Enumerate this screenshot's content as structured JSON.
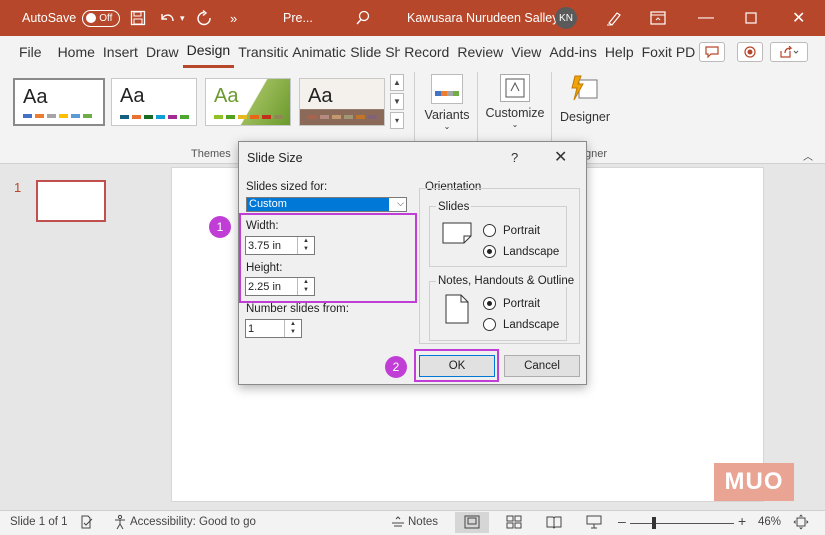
{
  "title_bar": {
    "autosave_label": "AutoSave",
    "autosave_state": "Off",
    "more_label": "»",
    "doc_title": "Pre...",
    "user_name": "Kawusara Nurudeen Salley",
    "user_initials": "KN"
  },
  "ribbon_tabs": [
    "File",
    "Home",
    "Insert",
    "Draw",
    "Design",
    "Transitio",
    "Animatic",
    "Slide Sho",
    "Record",
    "Review",
    "View",
    "Add-ins",
    "Help",
    "Foxit PD"
  ],
  "active_tab": "Design",
  "themes_group": {
    "label": "Themes",
    "thumb_text": "Aa"
  },
  "variants": {
    "label": "Variants"
  },
  "customize": {
    "label": "Customize"
  },
  "designer": {
    "label": "Designer",
    "group_label": "gner"
  },
  "slide_panel": {
    "slide_number": "1"
  },
  "dialog": {
    "title": "Slide Size",
    "help": "?",
    "close": "✕",
    "slides_sized_for_label": "Slides sized for:",
    "slides_sized_for_value": "Custom",
    "width_label": "Width:",
    "width_value": "3.75 in",
    "height_label": "Height:",
    "height_value": "2.25 in",
    "number_slides_label": "Number slides from:",
    "number_slides_value": "1",
    "orientation_label": "Orientation",
    "slides_section_label": "Slides",
    "portrait_label": "Portrait",
    "landscape_label": "Landscape",
    "notes_section_label": "Notes, Handouts & Outline",
    "notes_portrait_label": "Portrait",
    "notes_landscape_label": "Landscape",
    "ok_label": "OK",
    "cancel_label": "Cancel"
  },
  "annotations": {
    "badge_1": "1",
    "badge_2": "2"
  },
  "watermark": "MUO",
  "status_bar": {
    "slide_info": "Slide 1 of 1",
    "accessibility": "Accessibility: Good to go",
    "notes_label": "Notes",
    "zoom": "46%",
    "zoom_fraction": 0.46
  },
  "colors": {
    "title_bar": "#b7472a",
    "highlight": "#c03ed6",
    "selection": "#0078d7"
  }
}
